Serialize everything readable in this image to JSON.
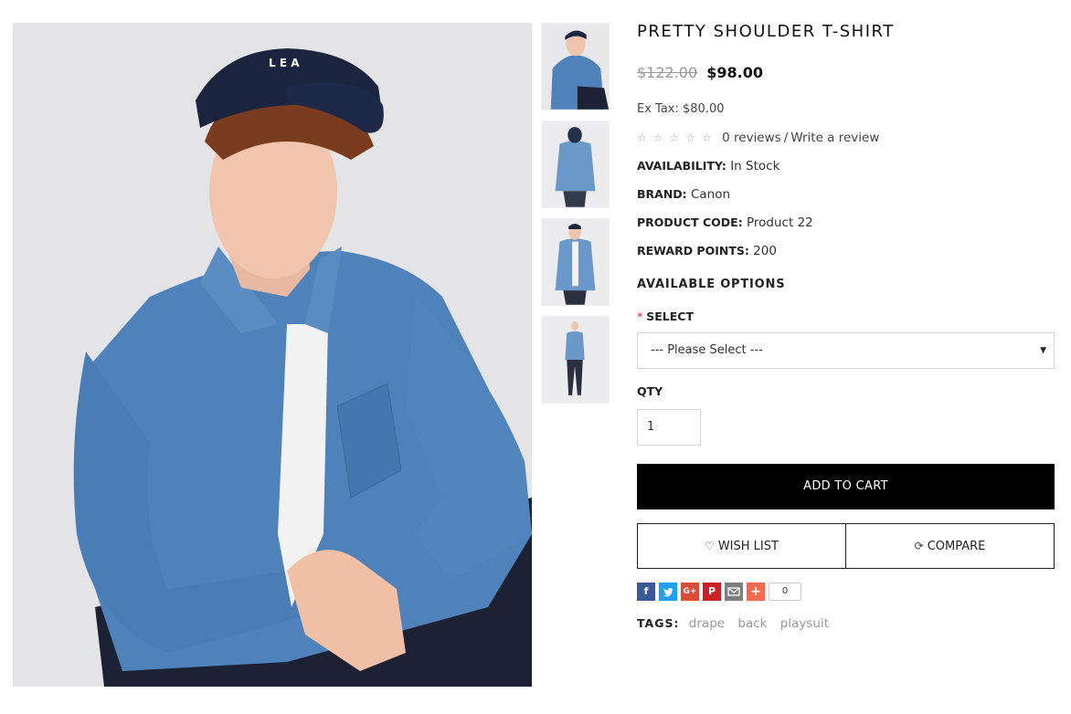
{
  "product": {
    "title": "PRETTY SHOULDER T-SHIRT",
    "price_old": "$122.00",
    "price_new": "$98.00",
    "ex_tax": "Ex Tax: $80.00",
    "rating": {
      "stars_filled": 0,
      "stars_total": 5,
      "reviews_link": "0 reviews",
      "separator": "/",
      "write_review_link": "Write a review"
    },
    "specs": {
      "availability_label": "AVAILABILITY:",
      "availability_value": "In Stock",
      "brand_label": "BRAND:",
      "brand_value": "Canon",
      "code_label": "PRODUCT CODE:",
      "code_value": "Product 22",
      "points_label": "REWARD POINTS:",
      "points_value": "200"
    }
  },
  "options": {
    "heading": "AVAILABLE OPTIONS",
    "required_marker": "*",
    "select_label": "SELECT",
    "select_value": "--- Please Select ---",
    "qty_label": "QTY",
    "qty_value": "1"
  },
  "actions": {
    "add_to_cart": "ADD TO CART",
    "wish_list": "WISH LIST",
    "compare": "COMPARE"
  },
  "share": {
    "icons": [
      "facebook-icon",
      "twitter-icon",
      "google-plus-icon",
      "pinterest-icon",
      "email-icon",
      "addthis-plus-icon"
    ],
    "facebook_glyph": "f",
    "google_glyph": "G+",
    "pinterest_glyph": "P",
    "plus_glyph": "+",
    "count": "0"
  },
  "tags": {
    "label": "TAGS:",
    "items": [
      "drape",
      "back",
      "playsuit"
    ]
  },
  "main_image": {
    "logo_text": "L E A"
  },
  "colors": {
    "cart_button": "#000000",
    "facebook": "#3b5998",
    "twitter": "#1da1f2",
    "google_plus": "#dd4b39",
    "pinterest": "#cb2027",
    "email": "#7d7d7d",
    "addthis": "#f8694d"
  }
}
